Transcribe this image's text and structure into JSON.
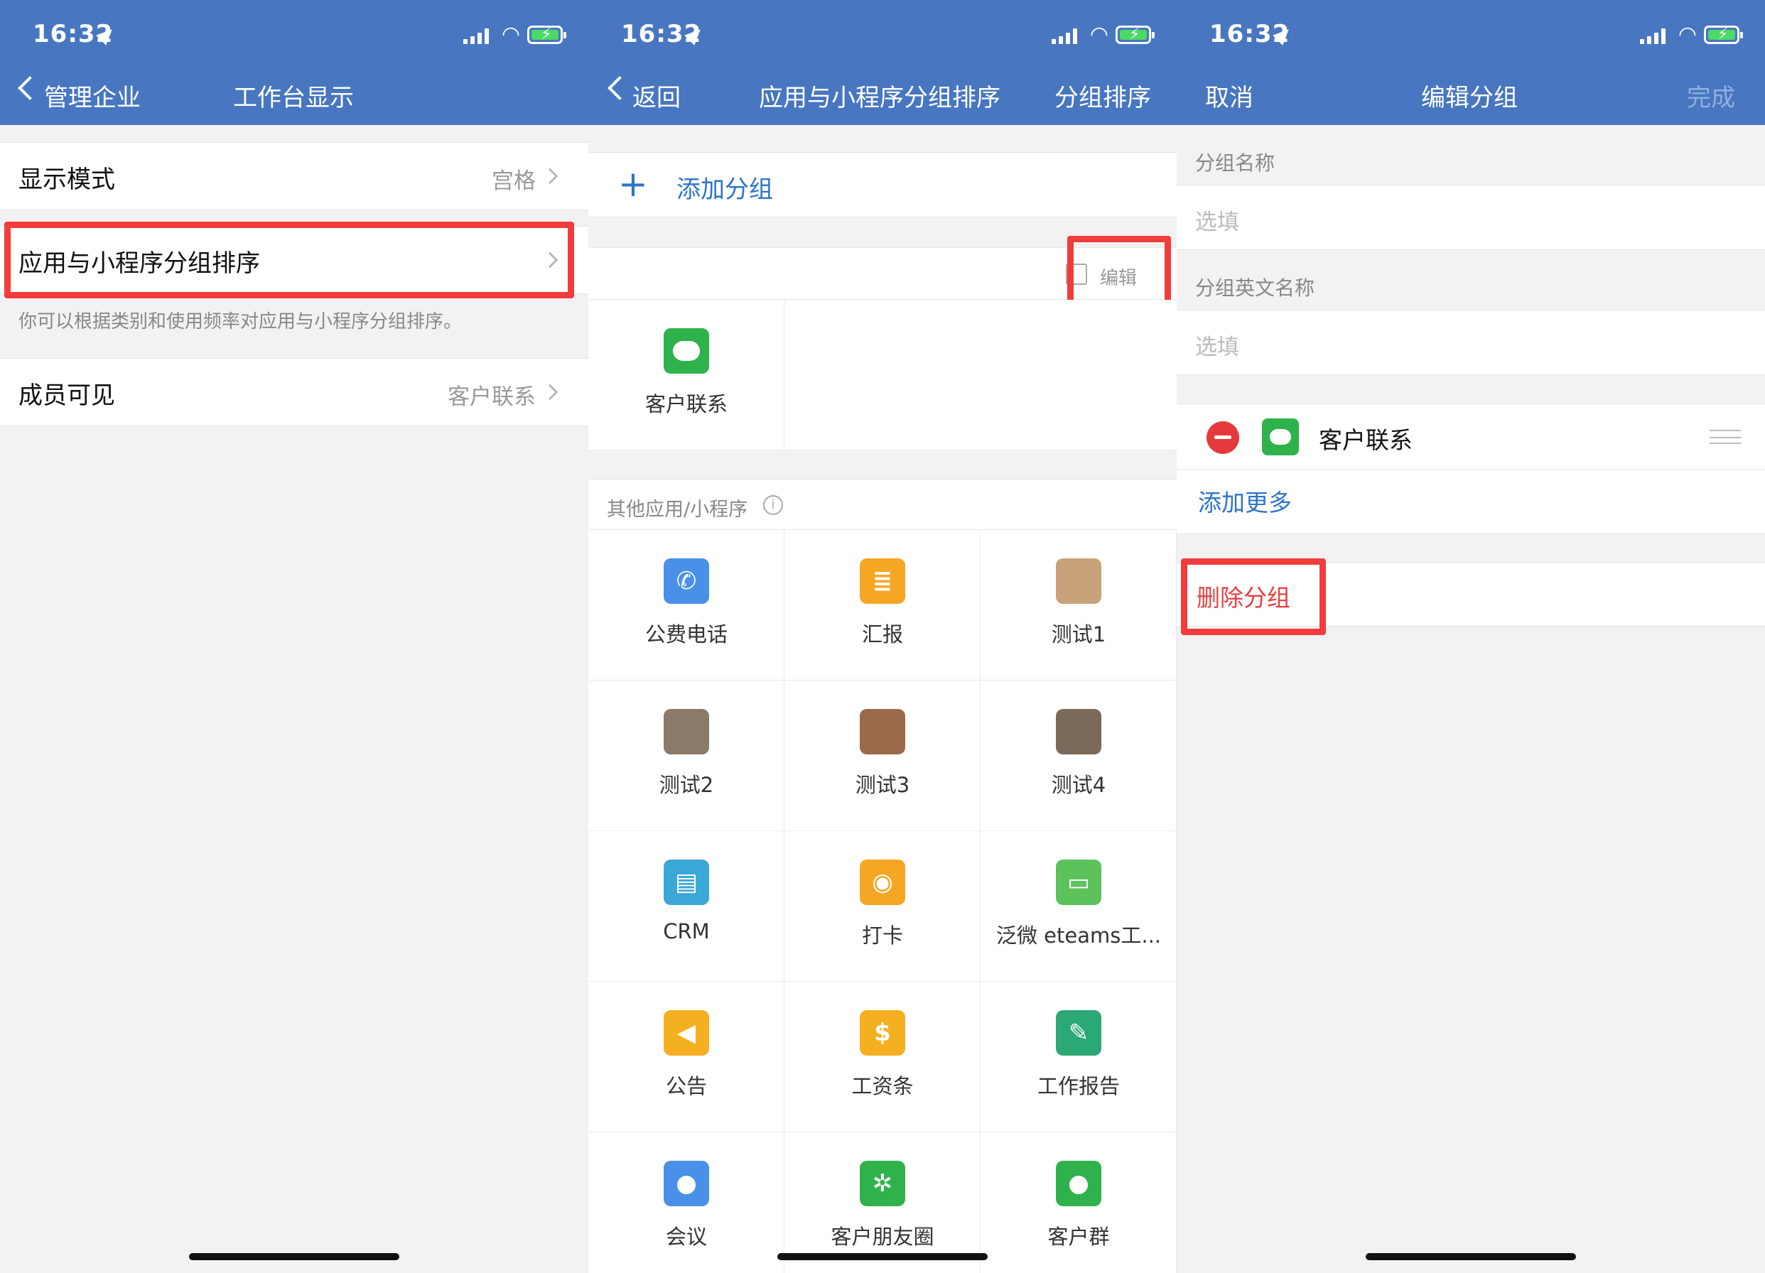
{
  "status_bar": {
    "time": "16:32"
  },
  "panel1": {
    "nav": {
      "back_label": "管理企业",
      "title": "工作台显示"
    },
    "rows": [
      {
        "label": "显示模式",
        "value": "宫格"
      },
      {
        "label": "应用与小程序分组排序",
        "value": ""
      },
      {
        "label": "成员可见",
        "value": "客户联系"
      }
    ],
    "hint": "你可以根据类别和使用频率对应用与小程序分组排序。"
  },
  "panel2": {
    "nav": {
      "back_label": "返回",
      "title": "应用与小程序分组排序",
      "right_label": "分组排序"
    },
    "add_group_label": "添加分组",
    "add_icon": "+",
    "edit_label": "编辑",
    "group_apps": [
      {
        "name": "客户联系",
        "icon": "chat-bubble-icon",
        "color": "#2fb24c"
      }
    ],
    "other_header": "其他应用/小程序",
    "info_glyph": "i",
    "apps": [
      {
        "name": "公费电话",
        "icon": "phone-icon",
        "color": "#4a90e8",
        "glyph": "✆"
      },
      {
        "name": "汇报",
        "icon": "report-icon",
        "color": "#f5a623",
        "glyph": "≣"
      },
      {
        "name": "测试1",
        "icon": "photo-icon",
        "color": "#c8a27a",
        "glyph": ""
      },
      {
        "name": "测试2",
        "icon": "photo-icon",
        "color": "#8a7a6a",
        "glyph": ""
      },
      {
        "name": "测试3",
        "icon": "photo-icon",
        "color": "#9a6a4a",
        "glyph": ""
      },
      {
        "name": "测试4",
        "icon": "photo-icon",
        "color": "#7a6a5a",
        "glyph": ""
      },
      {
        "name": "CRM",
        "icon": "id-card-icon",
        "color": "#3aa7d8",
        "glyph": "▤"
      },
      {
        "name": "打卡",
        "icon": "location-pin-icon",
        "color": "#f5a623",
        "glyph": "◉"
      },
      {
        "name": "泛微 eteams工...",
        "icon": "card-icon",
        "color": "#5cc25c",
        "glyph": "▭"
      },
      {
        "name": "公告",
        "icon": "megaphone-icon",
        "color": "#f5b021",
        "glyph": "◀"
      },
      {
        "name": "工资条",
        "icon": "salary-icon",
        "color": "#f5b021",
        "glyph": "$"
      },
      {
        "name": "工作报告",
        "icon": "edit-report-icon",
        "color": "#2aa876",
        "glyph": "✎"
      },
      {
        "name": "会议",
        "icon": "meeting-icon",
        "color": "#4a90e8",
        "glyph": "●"
      },
      {
        "name": "客户朋友圈",
        "icon": "aperture-icon",
        "color": "#2fb24c",
        "glyph": "✲"
      },
      {
        "name": "客户群",
        "icon": "group-icon",
        "color": "#2fb24c",
        "glyph": "●"
      }
    ]
  },
  "panel3": {
    "nav": {
      "left_label": "取消",
      "title": "编辑分组",
      "right_label": "完成"
    },
    "name_section": "分组名称",
    "name_placeholder": "选填",
    "en_section": "分组英文名称",
    "en_placeholder": "选填",
    "group_member": {
      "name": "客户联系",
      "icon": "chat-bubble-icon",
      "color": "#2fb24c"
    },
    "add_more_label": "添加更多",
    "delete_label": "删除分组",
    "colors": {
      "accent": "#2f74c8",
      "delete": "#e64040",
      "remove": "#e6393b"
    }
  }
}
